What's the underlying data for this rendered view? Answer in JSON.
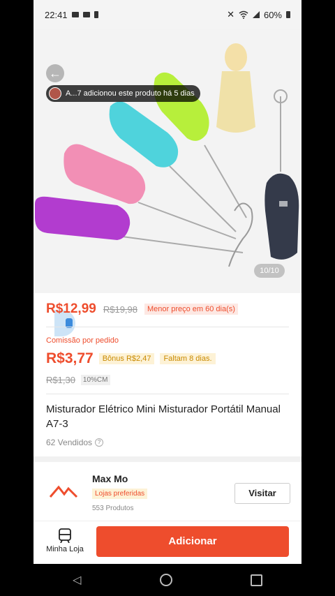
{
  "status_bar": {
    "time": "22:41",
    "battery": "60%"
  },
  "image": {
    "counter": "10/10"
  },
  "toast": {
    "text": "A...7 adicionou este produto há 5 dias"
  },
  "price": {
    "current": "R$12,99",
    "original": "R$19,98",
    "badge": "Menor preço em 60 dia(s)"
  },
  "commission": {
    "label": "Comissão por pedido",
    "value": "R$3,77",
    "bonus": "Bônus R$2,47",
    "remaining": "Faltam 8 dias.",
    "old_value": "R$1,30",
    "percent": "10%CM"
  },
  "product": {
    "title": "Misturador Elétrico Mini Misturador Portátil Manual A7-3",
    "sold": "62 Vendidos"
  },
  "store": {
    "name": "Max Mo",
    "tag": "Lojas preferidas",
    "products": "553 Produtos",
    "visit_label": "Visitar"
  },
  "bottom": {
    "shop_label": "Minha Loja",
    "add_label": "Adicionar"
  },
  "colors": {
    "accent": "#ee4d2d"
  }
}
